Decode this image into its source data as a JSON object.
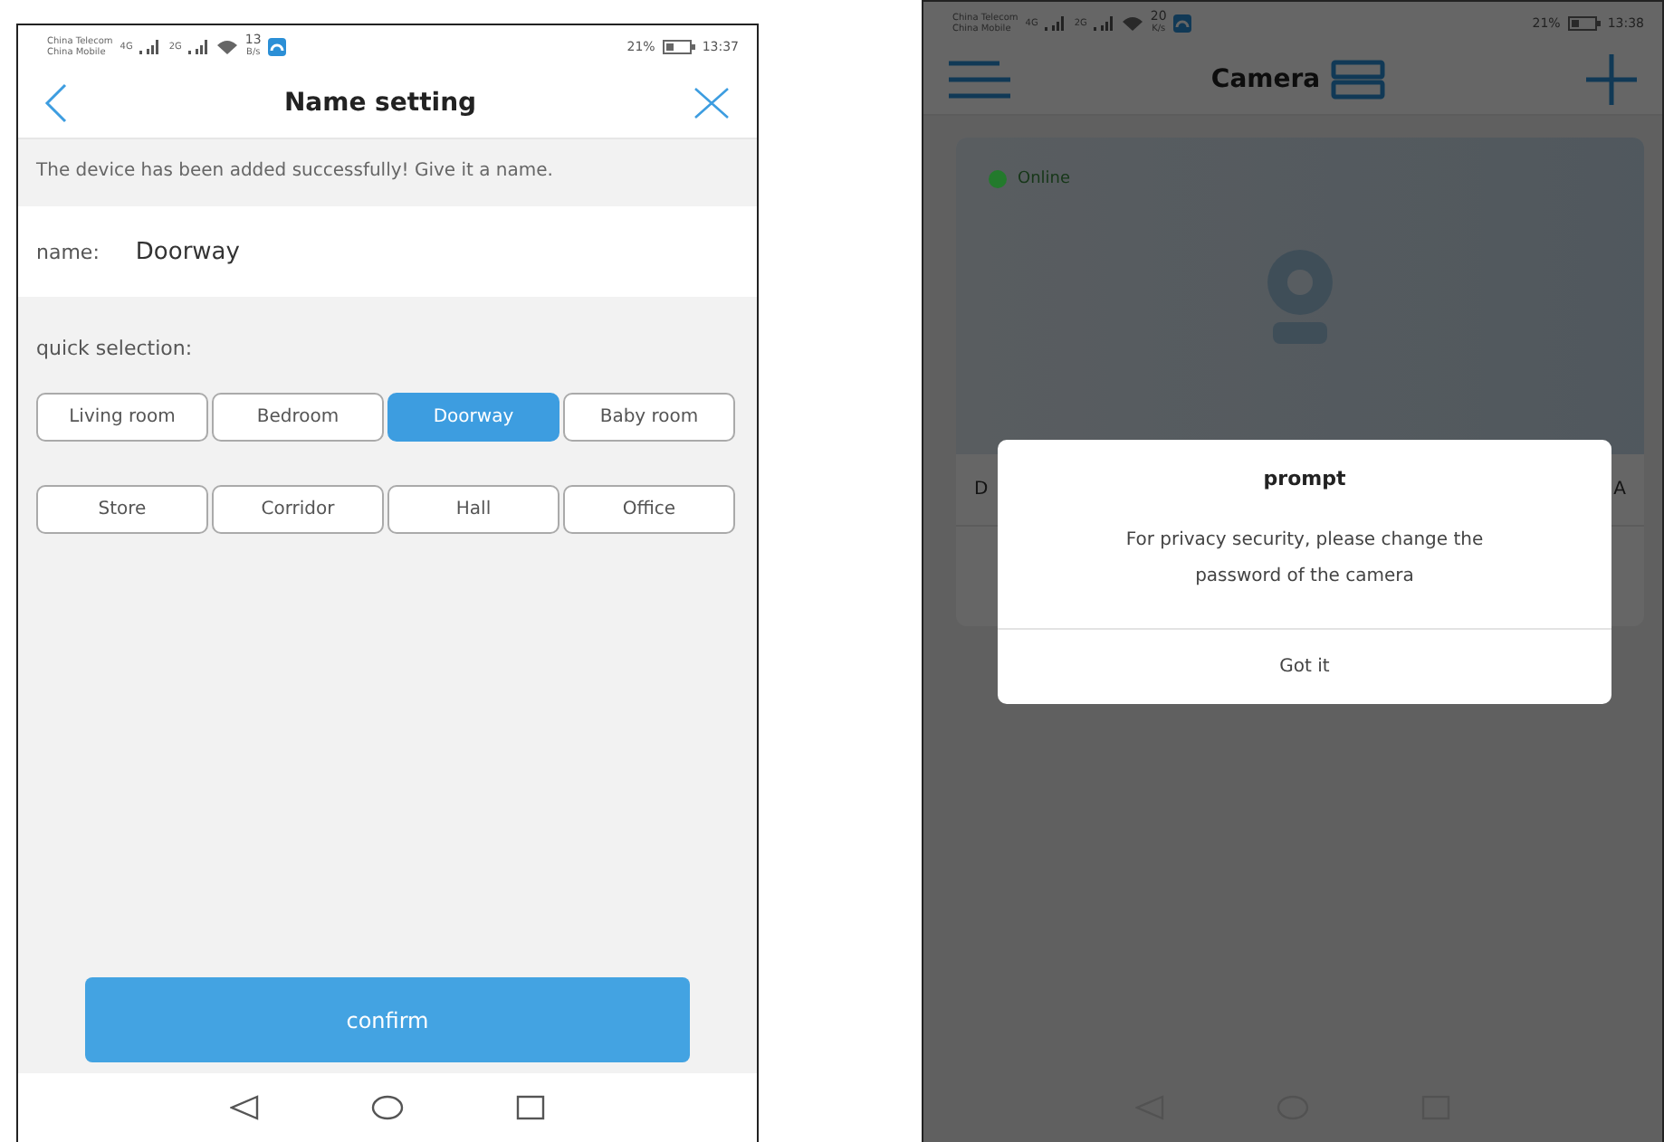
{
  "left_screen": {
    "status_bar": {
      "carriers": [
        "China Telecom",
        "China Mobile"
      ],
      "network": [
        "4G",
        "2G"
      ],
      "speed_value": "13",
      "speed_unit": "B/s",
      "battery": "21%",
      "time": "13:37"
    },
    "header": {
      "title": "Name setting"
    },
    "message": "The device has been added successfully! Give it a name.",
    "name_field": {
      "label": "name:",
      "value": "Doorway"
    },
    "quick_selection": {
      "label": "quick selection:",
      "options": [
        {
          "label": "Living room",
          "selected": false
        },
        {
          "label": "Bedroom",
          "selected": false
        },
        {
          "label": "Doorway",
          "selected": true
        },
        {
          "label": "Baby room",
          "selected": false
        },
        {
          "label": "Store",
          "selected": false
        },
        {
          "label": "Corridor",
          "selected": false
        },
        {
          "label": "Hall",
          "selected": false
        },
        {
          "label": "Office",
          "selected": false
        }
      ]
    },
    "confirm_button": "confirm"
  },
  "right_screen": {
    "status_bar": {
      "carriers": [
        "China Telecom",
        "China Mobile"
      ],
      "network": [
        "4G",
        "2G"
      ],
      "speed_value": "20",
      "speed_unit": "K/s",
      "battery": "21%",
      "time": "13:38"
    },
    "header": {
      "title": "Camera"
    },
    "camera_card": {
      "status": "Online",
      "color": "#237a2c",
      "name_fragment": "D",
      "action_fragment": "A"
    },
    "dialog": {
      "title": "prompt",
      "message": "For privacy security, please change the password of the camera",
      "button": "Got it"
    }
  }
}
